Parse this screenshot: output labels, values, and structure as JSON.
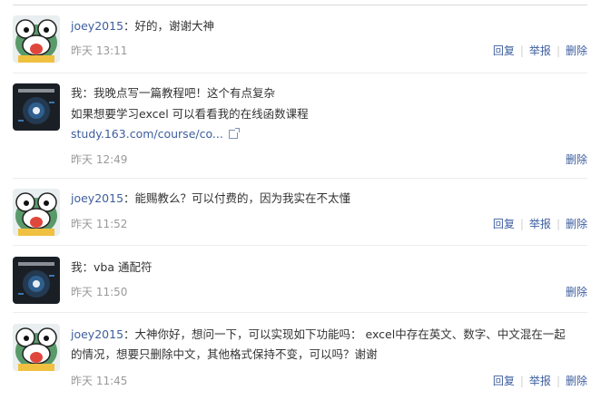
{
  "comments": [
    {
      "avatar": "frog-avatar",
      "user": "joey2015",
      "text": "好的，谢谢大神",
      "time": "昨天 13:11",
      "actions": [
        "回复",
        "举报",
        "删除"
      ]
    },
    {
      "avatar": "dark-chart-avatar",
      "user": "我",
      "text_lines": [
        "我晚点写一篇教程吧！这个有点复杂",
        "如果想要学习excel 可以看看我的在线函数课程"
      ],
      "link": "study.163.com/course/co...",
      "time": "昨天 12:49",
      "actions": [
        "删除"
      ]
    },
    {
      "avatar": "frog-avatar",
      "user": "joey2015",
      "text": "能赐教么？可以付费的，因为我实在不太懂",
      "time": "昨天 11:52",
      "actions": [
        "回复",
        "举报",
        "删除"
      ]
    },
    {
      "avatar": "dark-chart-avatar",
      "user": "我",
      "text": "vba 通配符",
      "time": "昨天 11:50",
      "actions": [
        "删除"
      ]
    },
    {
      "avatar": "frog-avatar",
      "user": "joey2015",
      "text_lines": [
        "大神你好，想问一下，可以实现如下功能吗： excel中存在英文、数字、中文混在一起",
        "的情况，想要只删除中文，其他格式保持不变，可以吗？谢谢"
      ],
      "time": "昨天 11:45",
      "actions": [
        "回复",
        "举报",
        "删除"
      ]
    }
  ],
  "colon": "："
}
